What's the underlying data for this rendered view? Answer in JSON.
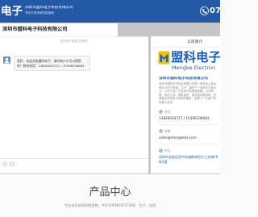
{
  "header": {
    "logo_text": "电子",
    "company_name": "深圳市盟科电子科技有限公司",
    "tagline": "专业半导体研发制造商",
    "phone_partial": "07"
  },
  "chat": {
    "title": "深圳市盟科电子科技有限公司",
    "notice": "盟科电子客服为您服务",
    "messages": [
      {
        "sender": "agent",
        "text": "您好，欢迎光临盟科电子，请问有什么可以帮您的？联系电话：13826030727 / 15396336683"
      }
    ]
  },
  "company_panel": {
    "heading": "公司简介",
    "logo_cn": "盟科电子",
    "logo_en": "Mengke Electron",
    "name": "深圳市盟科电子科技有限公司",
    "description": "深圳市盟科电子科技有限公司是一家专业从事功率MOSFET研发、生产、销售于一体的半导体企业。公司产品广泛应用于电源适配器、LED照明、电动工具、锂电保护、电机驱动等领域，凭借稳定的品质与优质的服务，赢得了广大客户的信赖与支持。",
    "phone": {
      "label": "电话",
      "value": "13826030727 / 15396336683"
    },
    "email": {
      "label": "邮箱",
      "value": "sales@mengkedz.com"
    },
    "address": {
      "label": "地址",
      "value": "深圳市宝安区西乡街道鹤洲恒丰工业城C6栋5楼"
    }
  },
  "section": {
    "title": "产品中心",
    "subtitle": "专业半导体研发制造商，专注功率MOSFET研发、生产、应用"
  },
  "icons": {
    "header_phone": "phone-icon",
    "avatar": "avatar-icon",
    "emoji": "smile-icon",
    "attach": "folder-icon",
    "logo": "logo-icon",
    "phone": "phone-icon",
    "email": "mail-icon",
    "address": "location-icon"
  },
  "colors": {
    "header_bg": "#2459a8",
    "brand_blue": "#1f5fb5",
    "logo_yellow": "#f2c200",
    "frame_gray": "#c6c6c6"
  }
}
